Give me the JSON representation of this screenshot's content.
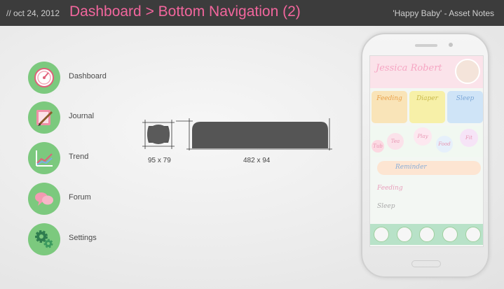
{
  "header": {
    "date": "// oct 24, 2012",
    "title": "Dashboard > Bottom Navigation (2)",
    "project": "'Happy Baby' - Asset Notes"
  },
  "icons": [
    {
      "label": "Dashboard",
      "icon": "gauge-icon"
    },
    {
      "label": "Journal",
      "icon": "journal-icon"
    },
    {
      "label": "Trend",
      "icon": "trend-chart-icon"
    },
    {
      "label": "Forum",
      "icon": "speech-bubbles-icon"
    },
    {
      "label": "Settings",
      "icon": "gears-icon"
    }
  ],
  "specs": {
    "button_size": "95 x 79",
    "bar_size": "482 x 94"
  },
  "phone": {
    "user_name": "Jessica Robert",
    "tiles": [
      "Feeding",
      "Diaper",
      "Sleep"
    ],
    "circles": [
      "Tea",
      "Play",
      "Food",
      "Fit",
      "Tub"
    ],
    "reminder": "Reminder",
    "rows": [
      "Feeding",
      "Sleep"
    ]
  },
  "colors": {
    "accent": "#f2669d",
    "icon_bg": "#7cc97e",
    "topbar": "#3c3c3c"
  }
}
